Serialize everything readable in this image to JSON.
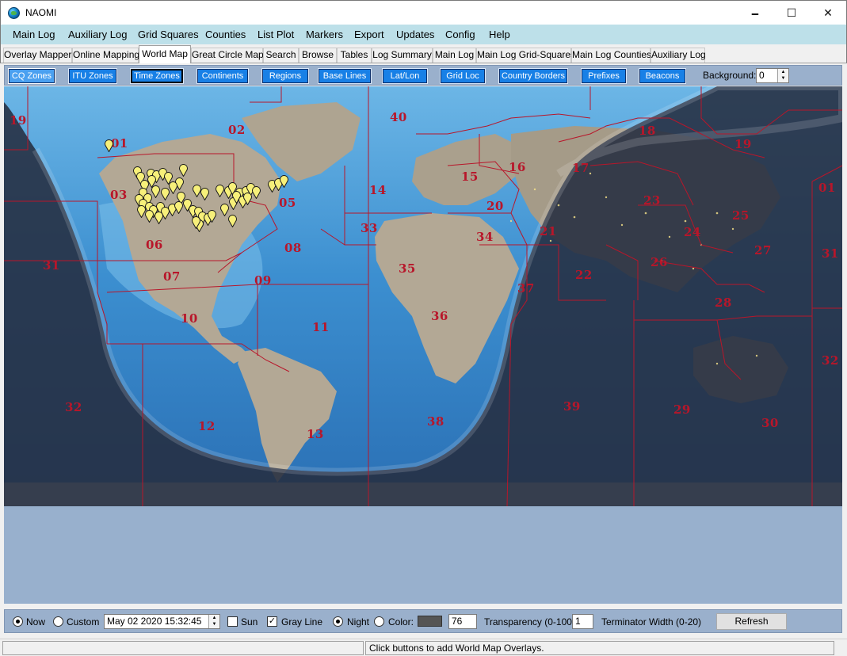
{
  "window": {
    "title": "NAOMI",
    "minimize_glyph": "🗕",
    "maximize_glyph": "☐",
    "close_glyph": "✕"
  },
  "menu": [
    "Main Log",
    "Auxiliary Log",
    "Grid Squares",
    "Counties",
    "List Plot",
    "Markers",
    "Export",
    "Updates",
    "Config",
    "Help"
  ],
  "tabs": {
    "items": [
      "Overlay Mapper",
      "Online Mapping",
      "World Map",
      "Great Circle Map",
      "Search",
      "Browse",
      "Tables",
      "Log Summary",
      "Main Log",
      "Main Log Grid-Squares",
      "Main Log Counties",
      "Auxiliary Log"
    ],
    "active": "World Map"
  },
  "overlays": {
    "buttons": [
      "CQ Zones",
      "ITU Zones",
      "Time Zones",
      "Continents",
      "Regions",
      "Base Lines",
      "Lat/Lon",
      "Grid Loc",
      "Country Borders",
      "Prefixes",
      "Beacons"
    ],
    "selected": "CQ Zones",
    "pressed": "Time Zones",
    "background_label": "Background:",
    "background_value": "0"
  },
  "map": {
    "zone_labels": [
      "19",
      "02",
      "40",
      "01",
      "18",
      "19",
      "03",
      "05",
      "14",
      "15",
      "16",
      "17",
      "01",
      "33",
      "20",
      "23",
      "25",
      "06",
      "08",
      "34",
      "21",
      "24",
      "27",
      "31",
      "07",
      "09",
      "35",
      "37",
      "22",
      "26",
      "31",
      "28",
      "10",
      "11",
      "36",
      "32",
      "39",
      "29",
      "30",
      "32",
      "12",
      "13",
      "38"
    ],
    "marker_color": "#f7f07a",
    "zone_color": "#b8162a",
    "ocean_color": "#3f8fd2",
    "land_color": "#b8ad9c",
    "night_color": "#2a3144"
  },
  "controls": {
    "now_label": "Now",
    "custom_label": "Custom",
    "datetime": "May 02 2020   15:32:45",
    "sun_label": "Sun",
    "gray_line_label": "Gray Line",
    "night_label": "Night",
    "color_label": "Color:",
    "transparency_value": "76",
    "transparency_label": "Transparency (0-100)",
    "terminator_value": "1",
    "terminator_label": "Terminator Width (0-20)",
    "refresh_label": "Refresh",
    "check_glyph": "✓"
  },
  "status": {
    "message": "Click buttons to add World Map Overlays."
  }
}
